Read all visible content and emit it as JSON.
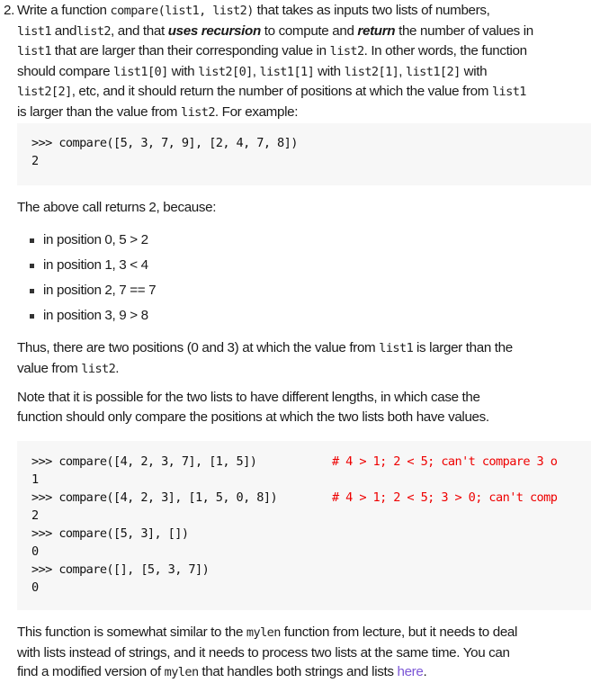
{
  "problem": {
    "number": "2.",
    "intro": {
      "t1": "Write a function ",
      "c1": "compare(list1, list2)",
      "t2": " that takes as inputs two lists of numbers,",
      "c2": "list1",
      "t3": " and",
      "c3": "list2",
      "t4": ", and that ",
      "e1": "uses recursion",
      "t5": " to compute and ",
      "e2": "return",
      "t6": " the number of values in",
      "c4": "list1",
      "t7": " that are larger than their corresponding value in ",
      "c5": "list2",
      "t8": ". In other words, the function",
      "t9": "should compare ",
      "c6": "list1[0]",
      "t10": " with ",
      "c7": "list2[0]",
      "t11": ", ",
      "c8": "list1[1]",
      "t12": " with ",
      "c9": "list2[1]",
      "t13": ", ",
      "c10": "list1[2]",
      "t14": " with",
      "c11": "list2[2]",
      "t15": ", etc, and it should return the number of positions at which the value from ",
      "c12": "list1",
      "t16": "is larger than the value from ",
      "c13": "list2",
      "t17": ". For example:"
    },
    "example1": {
      "lines": [
        ">>> compare([5, 3, 7, 9], [2, 4, 7, 8])",
        "2"
      ]
    },
    "explanation_lead": "The above call returns 2, because:",
    "bullets": [
      "in position 0, 5 > 2",
      "in position 1, 3 < 4",
      "in position 2, 7 == 7",
      "in position 3, 9 > 8"
    ],
    "thus": {
      "t1": "Thus, there are two positions (0 and 3) at which the value from ",
      "c1": "list1",
      "t2": " is larger than the",
      "t3": "value from ",
      "c2": "list2",
      "t4": "."
    },
    "note": {
      "line1": "Note that it is possible for the two lists to have different lengths, in which case the",
      "line2": "function should only compare the positions at which the two lists both have values."
    },
    "example2": {
      "lines": [
        {
          "code": ">>> compare([4, 2, 3, 7], [1, 5])",
          "comment": "# 4 > 1; 2 < 5; can't compare 3 o"
        },
        {
          "code": "1",
          "comment": ""
        },
        {
          "code": ">>> compare([4, 2, 3], [1, 5, 0, 8])",
          "comment": "# 4 > 1; 2 < 5; 3 > 0; can't comp"
        },
        {
          "code": "2",
          "comment": ""
        },
        {
          "code": ">>> compare([5, 3], [])",
          "comment": ""
        },
        {
          "code": "0",
          "comment": ""
        },
        {
          "code": ">>> compare([], [5, 3, 7])",
          "comment": ""
        },
        {
          "code": "0",
          "comment": ""
        }
      ],
      "comment_color": "#ee0000"
    },
    "closing": {
      "t1": "This function is somewhat similar to the ",
      "c1": "mylen",
      "t2": " function from lecture, but it needs to deal",
      "t3": "with lists instead of strings, and it needs to process two lists at the same time. You can",
      "t4": "find a modified version of ",
      "c2": "mylen",
      "t5": " that handles both strings and lists ",
      "link": "here",
      "t6": ".",
      "link_color": "#7b56d6"
    }
  }
}
